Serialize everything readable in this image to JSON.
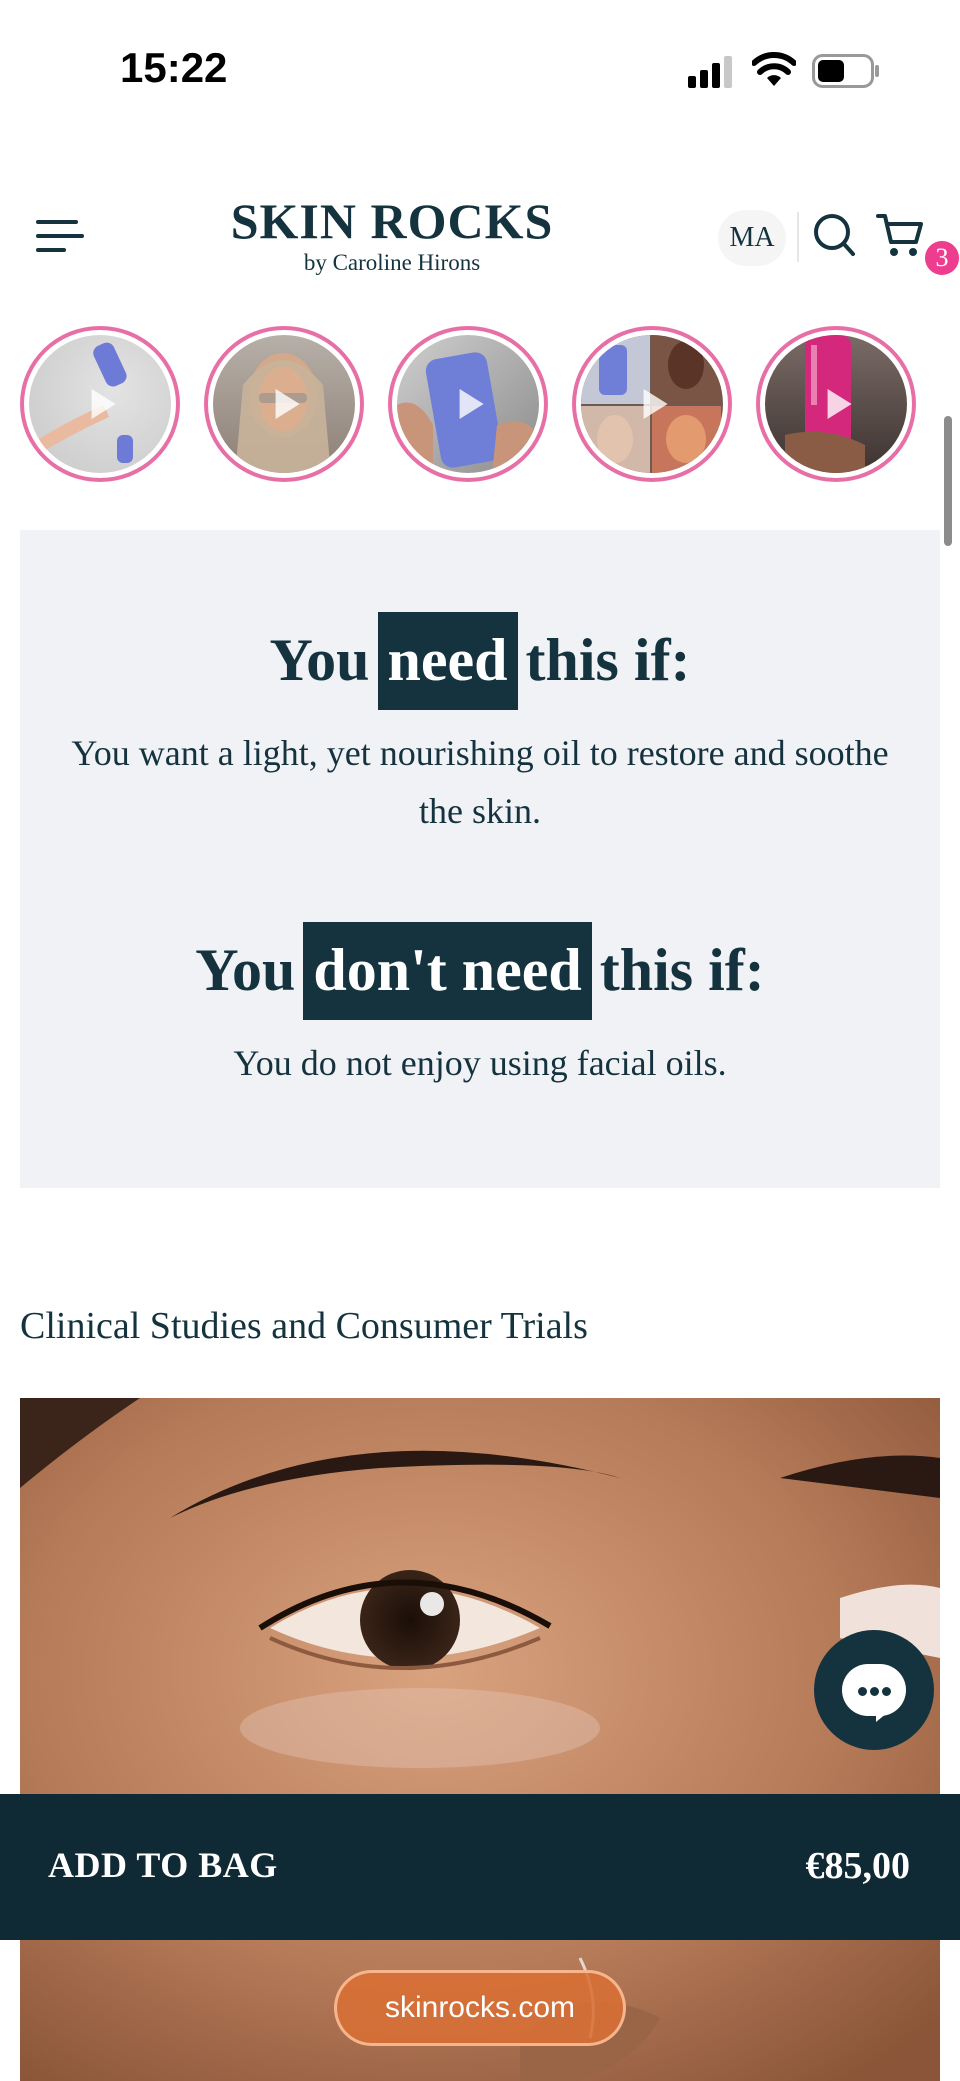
{
  "status_bar": {
    "time": "15:22",
    "icons": [
      "cellular-signal-icon",
      "wifi-icon",
      "battery-icon"
    ]
  },
  "header": {
    "logo_main": "SKIN ROCKS",
    "logo_sub": "by Caroline Hirons",
    "lang": "MA",
    "cart_count": "3",
    "icons": [
      "menu-icon",
      "search-icon",
      "cart-icon"
    ]
  },
  "stories": {
    "count": 5,
    "ring_color": "#e86fa6"
  },
  "need": {
    "need_prefix": "You",
    "need_highlight": "need",
    "need_suffix": "this if:",
    "need_text": "You want a light, yet nourishing oil to restore and soothe the skin.",
    "dont_prefix": "You",
    "dont_highlight": "don't need",
    "dont_suffix": "this if:",
    "dont_text": "You do not enjoy using facial oils."
  },
  "clinical": {
    "title": "Clinical Studies and Consumer Trials"
  },
  "bag": {
    "label": "ADD TO BAG",
    "price": "€85,00"
  },
  "url": {
    "text": "skinrocks.com"
  },
  "colors": {
    "brand_dark": "#14333f",
    "panel_bg": "#f1f2f6",
    "badge_pink": "#ee3d8f",
    "bag_bar": "#0f2935",
    "url_pill": "#d86e34"
  }
}
